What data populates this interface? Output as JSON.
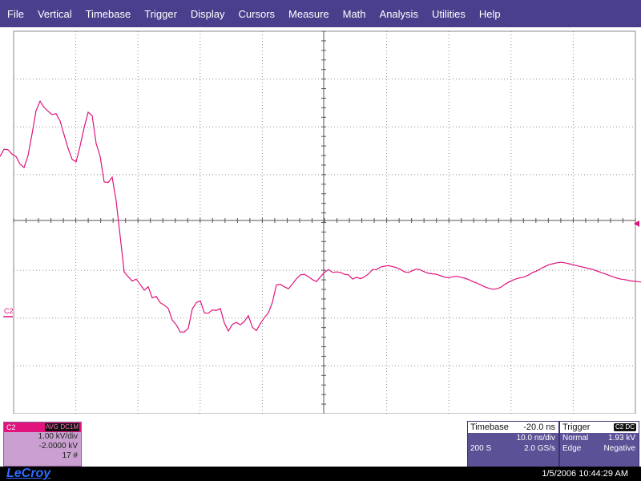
{
  "menu": [
    "File",
    "Vertical",
    "Timebase",
    "Trigger",
    "Display",
    "Cursors",
    "Measure",
    "Math",
    "Analysis",
    "Utilities",
    "Help"
  ],
  "trace": {
    "label": "C2",
    "color": "#e0147c",
    "x": [
      0,
      5,
      10,
      15,
      20,
      25,
      30,
      35,
      40,
      45,
      50,
      55,
      60,
      65,
      70,
      75,
      80,
      85,
      90,
      95,
      100,
      105,
      110,
      115,
      120,
      125,
      130,
      135,
      140,
      145,
      150,
      155,
      160,
      165,
      170,
      175,
      180,
      185,
      190,
      195,
      200,
      205,
      210,
      215,
      220,
      225,
      230,
      235,
      240,
      245,
      250,
      255,
      260,
      265,
      270,
      275,
      280,
      285,
      290,
      295,
      300,
      305,
      310,
      315,
      320,
      325,
      330,
      335,
      340,
      345,
      350,
      355,
      360,
      365,
      370,
      375,
      380,
      385,
      390,
      395,
      400,
      405,
      410,
      415,
      420,
      425,
      430,
      435,
      440,
      445,
      450,
      455,
      460,
      465,
      470,
      475,
      480,
      485,
      490,
      495,
      500,
      505,
      510,
      515,
      520,
      525,
      530,
      535,
      540,
      545,
      550,
      555,
      560,
      565,
      570,
      575,
      580,
      585,
      590,
      595,
      600,
      605,
      610,
      615,
      620,
      625,
      630,
      635,
      640,
      645,
      650,
      655,
      660,
      665,
      670,
      675,
      680,
      685,
      690,
      695,
      700,
      705,
      710,
      715,
      720,
      725,
      730,
      735,
      740,
      745,
      750,
      755,
      760,
      765,
      770,
      775,
      780,
      785,
      790,
      795,
      800
    ],
    "y": [
      1.33,
      1.48,
      1.47,
      1.38,
      1.33,
      1.17,
      1.1,
      1.35,
      1.8,
      2.28,
      2.48,
      2.35,
      2.27,
      2.2,
      2.22,
      2.07,
      1.78,
      1.5,
      1.27,
      1.22,
      1.55,
      1.93,
      2.25,
      2.18,
      1.6,
      1.33,
      0.8,
      0.79,
      0.9,
      0.4,
      -0.33,
      -1.07,
      -1.17,
      -1.26,
      -1.22,
      -1.33,
      -1.45,
      -1.38,
      -1.61,
      -1.58,
      -1.71,
      -1.76,
      -1.83,
      -2.07,
      -2.17,
      -2.32,
      -2.32,
      -2.24,
      -1.84,
      -1.71,
      -1.67,
      -1.92,
      -1.93,
      -1.86,
      -1.87,
      -1.83,
      -2.13,
      -2.3,
      -2.16,
      -2.12,
      -2.17,
      -2.1,
      -1.98,
      -2.22,
      -2.29,
      -2.14,
      -2.02,
      -1.92,
      -1.7,
      -1.34,
      -1.33,
      -1.38,
      -1.42,
      -1.32,
      -1.21,
      -1.13,
      -1.12,
      -1.17,
      -1.23,
      -1.27,
      -1.17,
      -1.08,
      -1.02,
      -1.08,
      -1.07,
      -1.08,
      -1.12,
      -1.13,
      -1.22,
      -1.18,
      -1.21,
      -1.17,
      -1.11,
      -1.02,
      -1.02,
      -0.97,
      -0.95,
      -0.94,
      -0.96,
      -0.98,
      -1.02,
      -1.07,
      -1.08,
      -1.04,
      -1.01,
      -1.03,
      -1.07,
      -1.1,
      -1.11,
      -1.12,
      -1.15,
      -1.18,
      -1.19,
      -1.17,
      -1.16,
      -1.18,
      -1.2,
      -1.23,
      -1.27,
      -1.3,
      -1.34,
      -1.38,
      -1.41,
      -1.43,
      -1.42,
      -1.39,
      -1.33,
      -1.28,
      -1.24,
      -1.21,
      -1.19,
      -1.17,
      -1.13,
      -1.08,
      -1.05,
      -1.0,
      -0.96,
      -0.92,
      -0.9,
      -0.88,
      -0.87,
      -0.88,
      -0.9,
      -0.92,
      -0.94,
      -0.96,
      -0.98,
      -1.0,
      -1.02,
      -1.05,
      -1.08,
      -1.11,
      -1.14,
      -1.17,
      -1.2,
      -1.22,
      -1.23,
      -1.25,
      -1.26,
      -1.27,
      -1.28,
      -1.29,
      -1.3
    ],
    "offset_marker_label": "C2"
  },
  "channel": {
    "name": "C2",
    "tag_avg": "AVG",
    "tag_dc": "DC1M",
    "vdiv": "1.00 kV/div",
    "offset": "-2.0000 kV",
    "sweeps": "17 #",
    "bg_color": "#c9a0cf",
    "head_color": "#e0147c"
  },
  "timebase": {
    "title": "Timebase",
    "delay": "-20.0 ns",
    "tdiv": "10.0 ns/div",
    "samples": "200 S",
    "rate": "2.0 GS/s"
  },
  "trigger": {
    "title": "Trigger",
    "tag": "C2 DC",
    "mode": "Normal",
    "level": "1.93 kV",
    "type": "Edge",
    "slope": "Negative"
  },
  "status": {
    "logo": "LeCroy",
    "datetime": "1/5/2006 10:44:29 AM"
  },
  "colors": {
    "menubar": "#4a3f8c",
    "grid": "#8a8a8a",
    "trace": "#e0147c",
    "info_box": "#5b5196"
  }
}
